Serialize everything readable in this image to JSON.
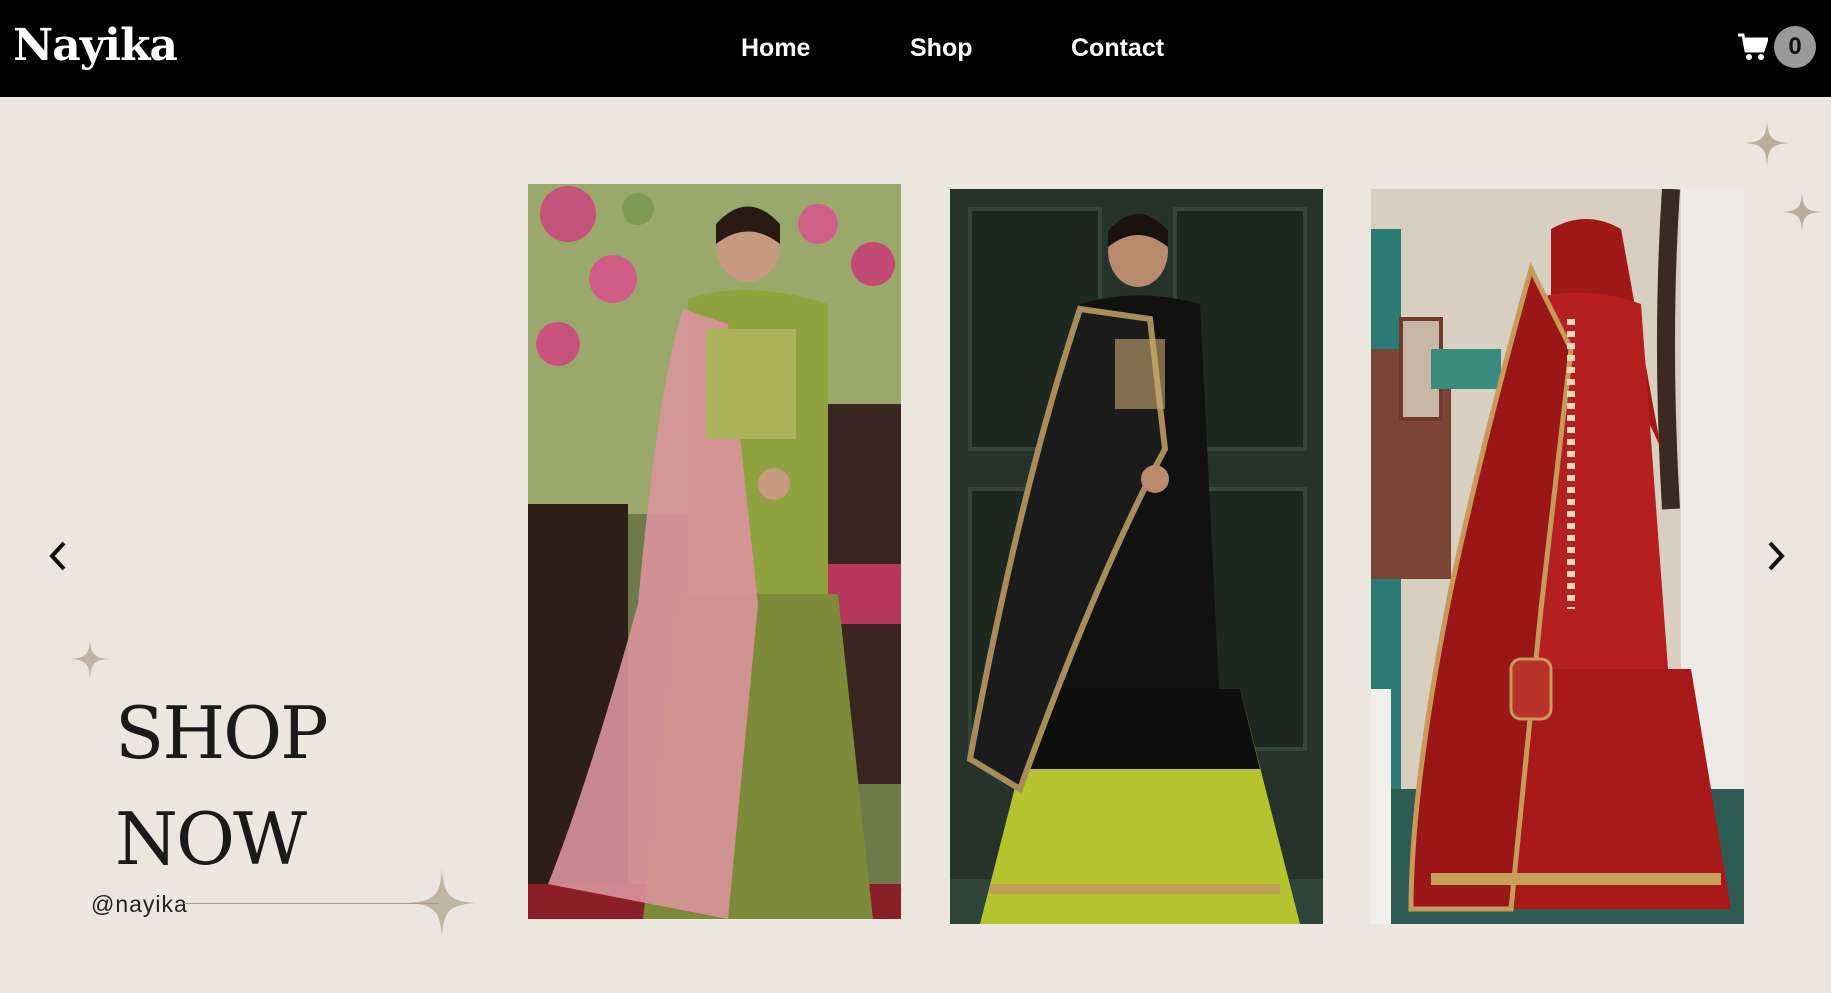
{
  "navbar": {
    "brand": "Nayika",
    "links": [
      "Home",
      "Shop",
      "Contact"
    ],
    "cart_count": "0"
  },
  "hero": {
    "headline_line1": "SHOP",
    "headline_line2": "NOW",
    "handle": "@nayika"
  },
  "carousel": {
    "items": [
      {
        "description": "Green gharara outfit with pink dupatta",
        "palette": [
          "#8a9a3c",
          "#d8909a"
        ]
      },
      {
        "description": "Black embroidered anarkali with lime lehenga",
        "palette": [
          "#141414",
          "#b5c42e"
        ]
      },
      {
        "description": "Red embroidered bridal lehenga",
        "palette": [
          "#b01c1c",
          "#8e1414"
        ]
      }
    ]
  },
  "colors": {
    "nav_bg": "#000000",
    "page_bg": "#ece7de",
    "cart_badge": "#9a9a9a",
    "sparkle": "#b9ad9b"
  },
  "icons": {
    "cart": "cart-icon",
    "prev": "chevron-left-icon",
    "next": "chevron-right-icon",
    "sparkle": "sparkle-icon"
  }
}
